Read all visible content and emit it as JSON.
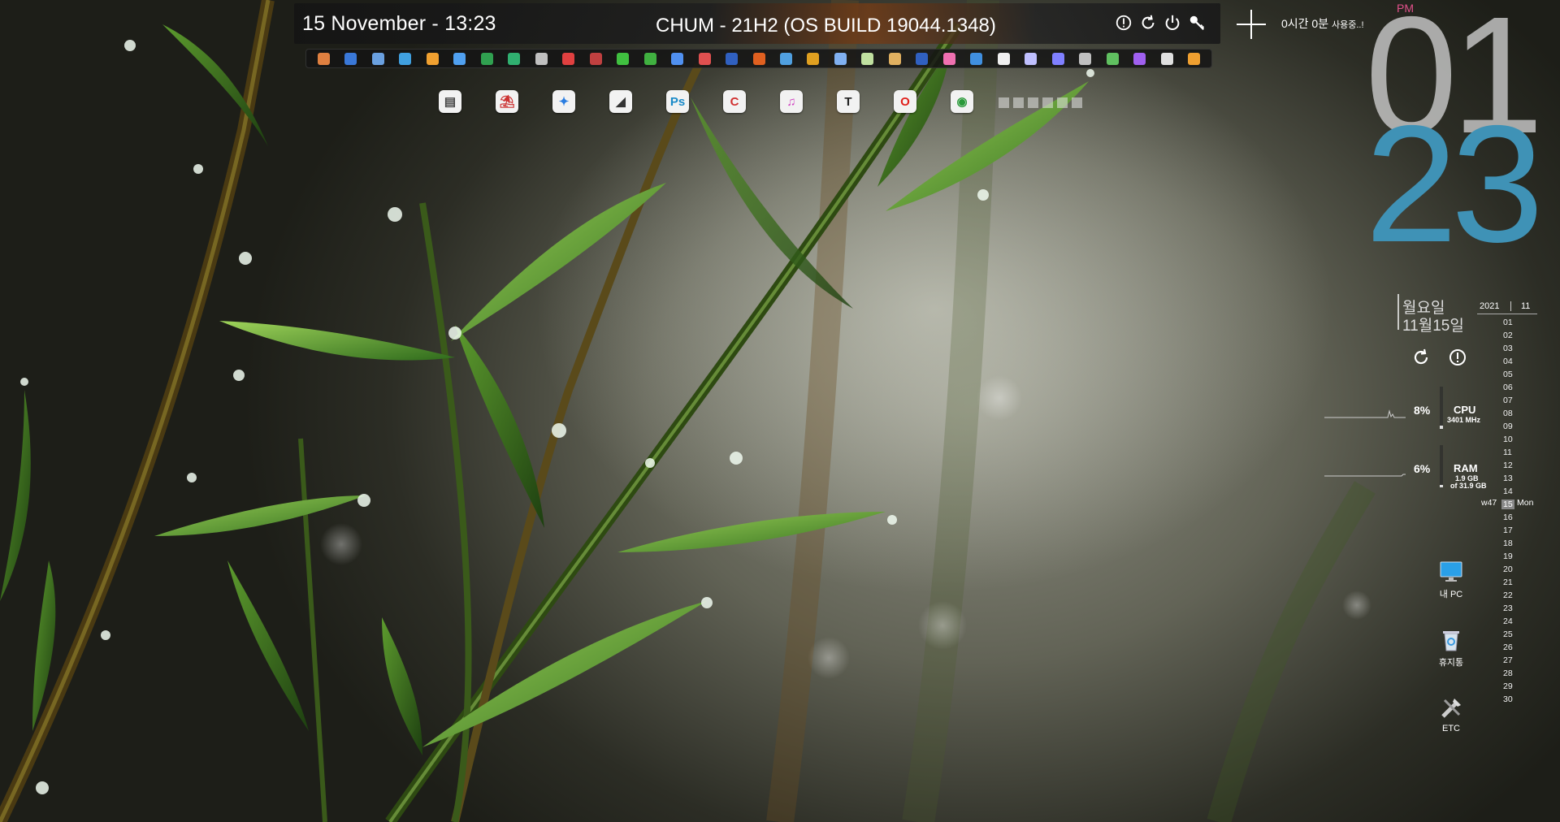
{
  "topbar": {
    "date_time": "15 November -  13:23",
    "system_title": "CHUM - 21H2 (OS BUILD 19044.1348)",
    "controls": [
      "info-icon",
      "refresh-icon",
      "power-icon",
      "key-icon"
    ]
  },
  "icon_strip": {
    "colors": [
      "#e08040",
      "#3a78d8",
      "#6aa0e0",
      "#40a0e0",
      "#f0a030",
      "#50a0f0",
      "#30a050",
      "#30b070",
      "#c0c0c0",
      "#e04040",
      "#c04040",
      "#40c040",
      "#40b040",
      "#5090f0",
      "#e05050",
      "#3060c0",
      "#e06020",
      "#50a0e0",
      "#e0a020",
      "#80b0f0",
      "#c0e0a0",
      "#e0b060",
      "#3060c0",
      "#f070b0",
      "#4090e0",
      "#f0f0f0",
      "#c0c0ff",
      "#8080ff",
      "#c0c0c0",
      "#60c060",
      "#a060f0",
      "#e0e0e0",
      "#f0a030"
    ]
  },
  "dock": {
    "items": [
      {
        "name": "disk-app-icon",
        "glyph": "▤",
        "color": "#444"
      },
      {
        "name": "umbrella-app-icon",
        "glyph": "⛱",
        "color": "#c33"
      },
      {
        "name": "wrench-app-icon",
        "glyph": "✦",
        "color": "#2a7de1"
      },
      {
        "name": "sail-app-icon",
        "glyph": "◢",
        "color": "#333"
      },
      {
        "name": "photoshop-icon",
        "glyph": "Ps",
        "color": "#1a8ac8"
      },
      {
        "name": "ccleaner-icon",
        "glyph": "C",
        "color": "#d03030"
      },
      {
        "name": "itunes-icon",
        "glyph": "♫",
        "color": "#d040c0"
      },
      {
        "name": "typora-icon",
        "glyph": "T",
        "color": "#222"
      },
      {
        "name": "opera-icon",
        "glyph": "O",
        "color": "#e0201c"
      },
      {
        "name": "chrome-icon",
        "glyph": "◉",
        "color": "#2a9a3a"
      }
    ],
    "page_dots": 6
  },
  "usage": {
    "text": "0시간 0분",
    "suffix": "사용중..!"
  },
  "clock": {
    "ampm": "PM",
    "hour": "01",
    "minute": "23"
  },
  "korean_date": {
    "weekday": "월요일",
    "date": "11월15일"
  },
  "calendar": {
    "year": "2021",
    "month": "11",
    "week": "w47",
    "today": "15",
    "today_dow": "Mon",
    "days_before": [
      "01",
      "02",
      "03",
      "04",
      "05",
      "06",
      "07",
      "08",
      "09",
      "10",
      "11",
      "12",
      "13",
      "14"
    ],
    "days_after": [
      "16",
      "17",
      "18",
      "19",
      "20",
      "21",
      "22",
      "23",
      "24",
      "25",
      "26",
      "27",
      "28",
      "29",
      "30"
    ]
  },
  "cpu": {
    "percent": "8%",
    "label": "CPU",
    "detail": "3401 MHz",
    "level": 0.08
  },
  "ram": {
    "percent": "6%",
    "label": "RAM",
    "detail1": "1.9 GB",
    "detail2": "of 31.9 GB",
    "level": 0.06
  },
  "desktop_icons": [
    {
      "label": "내 PC",
      "icon": "monitor-icon"
    },
    {
      "label": "휴지통",
      "icon": "recycle-bin-icon"
    },
    {
      "label": "ETC",
      "icon": "tools-icon"
    }
  ]
}
